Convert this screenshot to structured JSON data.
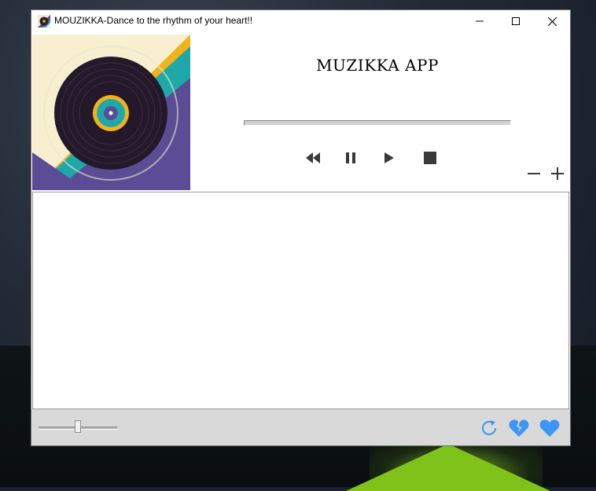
{
  "window": {
    "title": "MOUZIKKA-Dance to the rhythm of your heart!!"
  },
  "header": {
    "app_title": "MUZIKKA APP"
  },
  "player": {
    "progress_percent": 0
  },
  "controls": {
    "icons": [
      "rewind-icon",
      "pause-icon",
      "play-icon",
      "stop-icon"
    ],
    "volume_icons": [
      "minus-icon",
      "plus-icon"
    ]
  },
  "playlist": {
    "items": []
  },
  "bottom_bar": {
    "volume_fraction": 0.5,
    "icons": [
      "refresh-icon",
      "broken-heart-icon",
      "heart-icon"
    ],
    "accent_color": "#3b97f3"
  }
}
